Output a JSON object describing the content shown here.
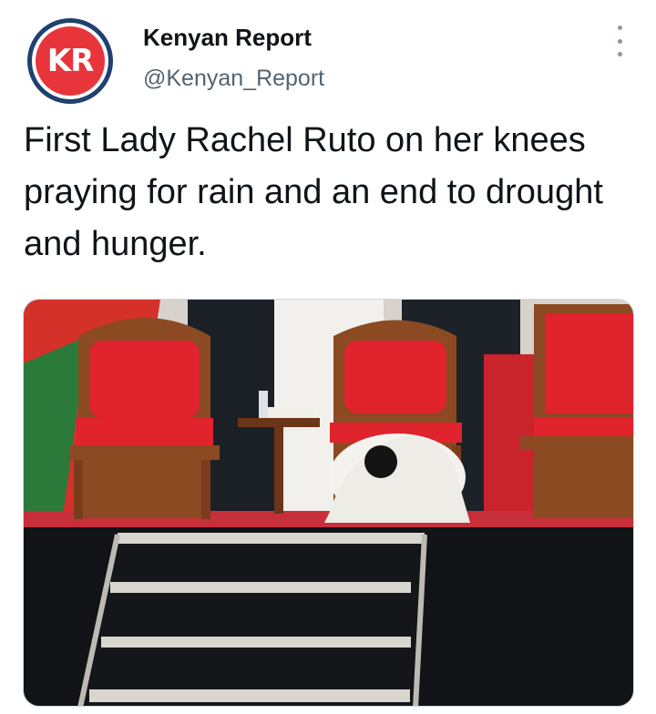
{
  "account": {
    "avatar_text": "KR",
    "display_name": "Kenyan Report",
    "handle": "@Kenyan_Report"
  },
  "tweet": {
    "text": "First Lady Rachel Ruto on her knees praying for rain and an end to drought and hunger."
  },
  "icons": {
    "more": "more-options-icon"
  },
  "colors": {
    "avatar_red": "#e8343b",
    "avatar_ring": "#1f4170",
    "handle_gray": "#536471"
  }
}
